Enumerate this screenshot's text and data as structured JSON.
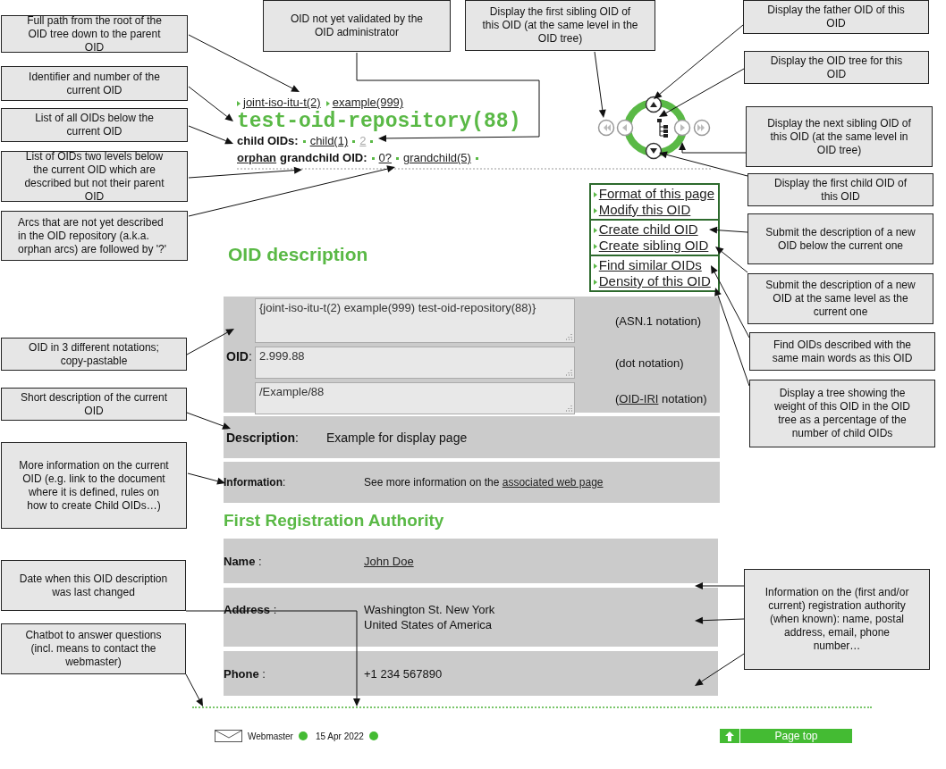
{
  "callouts": [
    {
      "text": "Full path from the root of the OID tree down to the parent OID"
    },
    {
      "text": "Identifier and number of the current OID"
    },
    {
      "text": "List of all OIDs below the current OID"
    },
    {
      "text": "List of OIDs two levels below the current OID which are described but not their parent OID"
    },
    {
      "text": "Arcs that are not yet described in the OID repository (a.k.a. orphan arcs) are followed by '?'"
    },
    {
      "text": "OID not yet validated by the OID administrator"
    },
    {
      "text": "Display the first sibling OID of this OID (at the same level in the OID tree)"
    },
    {
      "text": "Display the father OID of this OID"
    },
    {
      "text": "Display the OID tree for this OID"
    },
    {
      "text": "Display the next sibling OID of this OID (at the same level in OID tree)"
    },
    {
      "text": "Display the first child OID of this OID"
    },
    {
      "text": "Submit the description of a new OID below the current one"
    },
    {
      "text": "Submit the description of a new OID at the same level as the current one"
    },
    {
      "text": "Find OIDs described with the same main words as this OID"
    },
    {
      "text": "Display a tree showing the weight of this OID in the OID tree as a percentage of the number of child OIDs"
    },
    {
      "text": "OID in 3 different notations; copy-pastable"
    },
    {
      "text": "Short description of the current OID"
    },
    {
      "text": "More information on the current OID (e.g. link to the document where it is defined, rules on how to create Child OIDs…)"
    },
    {
      "text": "Date when this OID description was last changed"
    },
    {
      "text": "Chatbot to answer questions (incl. means to contact the webmaster)"
    },
    {
      "text": "Information on the (first and/or current) registration authority (when known): name, postal address, email, phone number…"
    }
  ],
  "breadcrumb": [
    {
      "label": "joint-iso-itu-t(2)"
    },
    {
      "label": "example(999)"
    }
  ],
  "title": "test-oid-repository(88)",
  "child_oids": {
    "label": "child OIDs:",
    "items": [
      {
        "label": "child(1)",
        "kind": "described"
      },
      {
        "label": "2",
        "kind": "pending"
      }
    ]
  },
  "orphan_grandchildren": {
    "link": "orphan",
    "label": "grandchild OID:",
    "items": [
      {
        "label": "0?"
      },
      {
        "label": "grandchild(5)"
      }
    ]
  },
  "actions": [
    {
      "links": [
        "Format of this page",
        "Modify this OID"
      ]
    },
    {
      "links": [
        "Create child OID",
        "Create sibling OID"
      ]
    },
    {
      "links": [
        "Find similar OIDs",
        "Density of this OID"
      ]
    }
  ],
  "oid_description": {
    "heading": "OID description",
    "oid_label": "**OID**:",
    "notations": [
      {
        "value": "{joint-iso-itu-t(2) example(999) test-oid-repository(88)}",
        "note": "(ASN.1 notation)"
      },
      {
        "value": "2.999.88",
        "note": "(dot notation)"
      },
      {
        "value": "/Example/88",
        "note": "(",
        "note_link": "OID-IRI",
        "note_after": " notation)"
      }
    ],
    "description": {
      "label": "**Description**:",
      "value": "Example for display page"
    },
    "information": {
      "label": "**Information**:",
      "text": "See more information on the",
      "link": "associated web page"
    }
  },
  "registration_authority": {
    "heading": "First Registration Authority",
    "rows": [
      {
        "label": "**Name** :",
        "lines": [
          "John Doe"
        ],
        "kind": "link"
      },
      {
        "label": "**Address** :",
        "lines": [
          "Washington St. New York",
          "United States of America"
        ],
        "kind": "text"
      },
      {
        "label": "**Phone** :",
        "lines": [
          "+1 234 567890"
        ],
        "kind": "text"
      }
    ]
  },
  "footer": {
    "webmaster": "Webmaster",
    "date": "15 Apr 2022",
    "page_top": "Page top"
  }
}
